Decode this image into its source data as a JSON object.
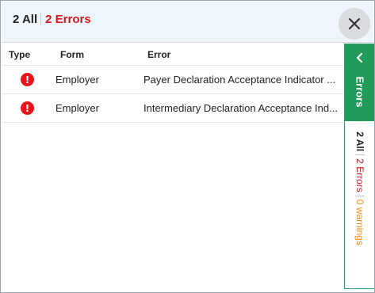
{
  "summary": {
    "all_label": "2 All",
    "errors_label": "2 Errors"
  },
  "close_icon": "close-icon",
  "table": {
    "headers": {
      "type": "Type",
      "form": "Form",
      "error": "Error"
    },
    "rows": [
      {
        "type_icon": "error-icon",
        "form": "Employer",
        "error": "Payer Declaration Acceptance Indicator ..."
      },
      {
        "type_icon": "error-icon",
        "form": "Employer",
        "error": "Intermediary Declaration Acceptance Ind..."
      }
    ]
  },
  "side_panel": {
    "tab_label": "Errors",
    "tab_icon": "chevron-left-icon",
    "all_label": "2 All",
    "errors_label": "2 Errors",
    "warnings_label": "0 warnings"
  },
  "colors": {
    "error_red": "#d4161c",
    "accent_green": "#1f9a58",
    "warning_orange": "#f08a1c",
    "header_bg": "#eef6fb"
  }
}
